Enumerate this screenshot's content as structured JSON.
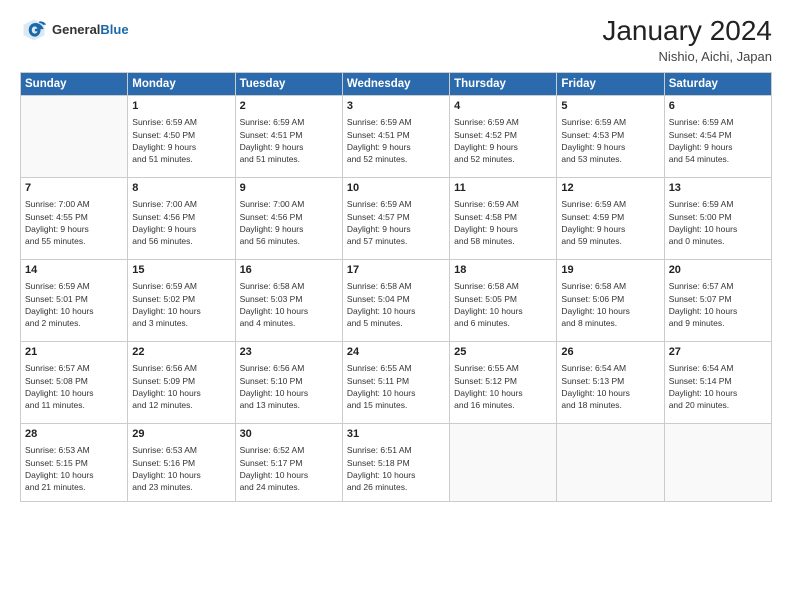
{
  "header": {
    "logo_general": "General",
    "logo_blue": "Blue",
    "month": "January 2024",
    "location": "Nishio, Aichi, Japan"
  },
  "weekdays": [
    "Sunday",
    "Monday",
    "Tuesday",
    "Wednesday",
    "Thursday",
    "Friday",
    "Saturday"
  ],
  "weeks": [
    [
      {
        "day": "",
        "info": ""
      },
      {
        "day": "1",
        "info": "Sunrise: 6:59 AM\nSunset: 4:50 PM\nDaylight: 9 hours\nand 51 minutes."
      },
      {
        "day": "2",
        "info": "Sunrise: 6:59 AM\nSunset: 4:51 PM\nDaylight: 9 hours\nand 51 minutes."
      },
      {
        "day": "3",
        "info": "Sunrise: 6:59 AM\nSunset: 4:51 PM\nDaylight: 9 hours\nand 52 minutes."
      },
      {
        "day": "4",
        "info": "Sunrise: 6:59 AM\nSunset: 4:52 PM\nDaylight: 9 hours\nand 52 minutes."
      },
      {
        "day": "5",
        "info": "Sunrise: 6:59 AM\nSunset: 4:53 PM\nDaylight: 9 hours\nand 53 minutes."
      },
      {
        "day": "6",
        "info": "Sunrise: 6:59 AM\nSunset: 4:54 PM\nDaylight: 9 hours\nand 54 minutes."
      }
    ],
    [
      {
        "day": "7",
        "info": "Sunrise: 7:00 AM\nSunset: 4:55 PM\nDaylight: 9 hours\nand 55 minutes."
      },
      {
        "day": "8",
        "info": "Sunrise: 7:00 AM\nSunset: 4:56 PM\nDaylight: 9 hours\nand 56 minutes."
      },
      {
        "day": "9",
        "info": "Sunrise: 7:00 AM\nSunset: 4:56 PM\nDaylight: 9 hours\nand 56 minutes."
      },
      {
        "day": "10",
        "info": "Sunrise: 6:59 AM\nSunset: 4:57 PM\nDaylight: 9 hours\nand 57 minutes."
      },
      {
        "day": "11",
        "info": "Sunrise: 6:59 AM\nSunset: 4:58 PM\nDaylight: 9 hours\nand 58 minutes."
      },
      {
        "day": "12",
        "info": "Sunrise: 6:59 AM\nSunset: 4:59 PM\nDaylight: 9 hours\nand 59 minutes."
      },
      {
        "day": "13",
        "info": "Sunrise: 6:59 AM\nSunset: 5:00 PM\nDaylight: 10 hours\nand 0 minutes."
      }
    ],
    [
      {
        "day": "14",
        "info": "Sunrise: 6:59 AM\nSunset: 5:01 PM\nDaylight: 10 hours\nand 2 minutes."
      },
      {
        "day": "15",
        "info": "Sunrise: 6:59 AM\nSunset: 5:02 PM\nDaylight: 10 hours\nand 3 minutes."
      },
      {
        "day": "16",
        "info": "Sunrise: 6:58 AM\nSunset: 5:03 PM\nDaylight: 10 hours\nand 4 minutes."
      },
      {
        "day": "17",
        "info": "Sunrise: 6:58 AM\nSunset: 5:04 PM\nDaylight: 10 hours\nand 5 minutes."
      },
      {
        "day": "18",
        "info": "Sunrise: 6:58 AM\nSunset: 5:05 PM\nDaylight: 10 hours\nand 6 minutes."
      },
      {
        "day": "19",
        "info": "Sunrise: 6:58 AM\nSunset: 5:06 PM\nDaylight: 10 hours\nand 8 minutes."
      },
      {
        "day": "20",
        "info": "Sunrise: 6:57 AM\nSunset: 5:07 PM\nDaylight: 10 hours\nand 9 minutes."
      }
    ],
    [
      {
        "day": "21",
        "info": "Sunrise: 6:57 AM\nSunset: 5:08 PM\nDaylight: 10 hours\nand 11 minutes."
      },
      {
        "day": "22",
        "info": "Sunrise: 6:56 AM\nSunset: 5:09 PM\nDaylight: 10 hours\nand 12 minutes."
      },
      {
        "day": "23",
        "info": "Sunrise: 6:56 AM\nSunset: 5:10 PM\nDaylight: 10 hours\nand 13 minutes."
      },
      {
        "day": "24",
        "info": "Sunrise: 6:55 AM\nSunset: 5:11 PM\nDaylight: 10 hours\nand 15 minutes."
      },
      {
        "day": "25",
        "info": "Sunrise: 6:55 AM\nSunset: 5:12 PM\nDaylight: 10 hours\nand 16 minutes."
      },
      {
        "day": "26",
        "info": "Sunrise: 6:54 AM\nSunset: 5:13 PM\nDaylight: 10 hours\nand 18 minutes."
      },
      {
        "day": "27",
        "info": "Sunrise: 6:54 AM\nSunset: 5:14 PM\nDaylight: 10 hours\nand 20 minutes."
      }
    ],
    [
      {
        "day": "28",
        "info": "Sunrise: 6:53 AM\nSunset: 5:15 PM\nDaylight: 10 hours\nand 21 minutes."
      },
      {
        "day": "29",
        "info": "Sunrise: 6:53 AM\nSunset: 5:16 PM\nDaylight: 10 hours\nand 23 minutes."
      },
      {
        "day": "30",
        "info": "Sunrise: 6:52 AM\nSunset: 5:17 PM\nDaylight: 10 hours\nand 24 minutes."
      },
      {
        "day": "31",
        "info": "Sunrise: 6:51 AM\nSunset: 5:18 PM\nDaylight: 10 hours\nand 26 minutes."
      },
      {
        "day": "",
        "info": ""
      },
      {
        "day": "",
        "info": ""
      },
      {
        "day": "",
        "info": ""
      }
    ]
  ]
}
